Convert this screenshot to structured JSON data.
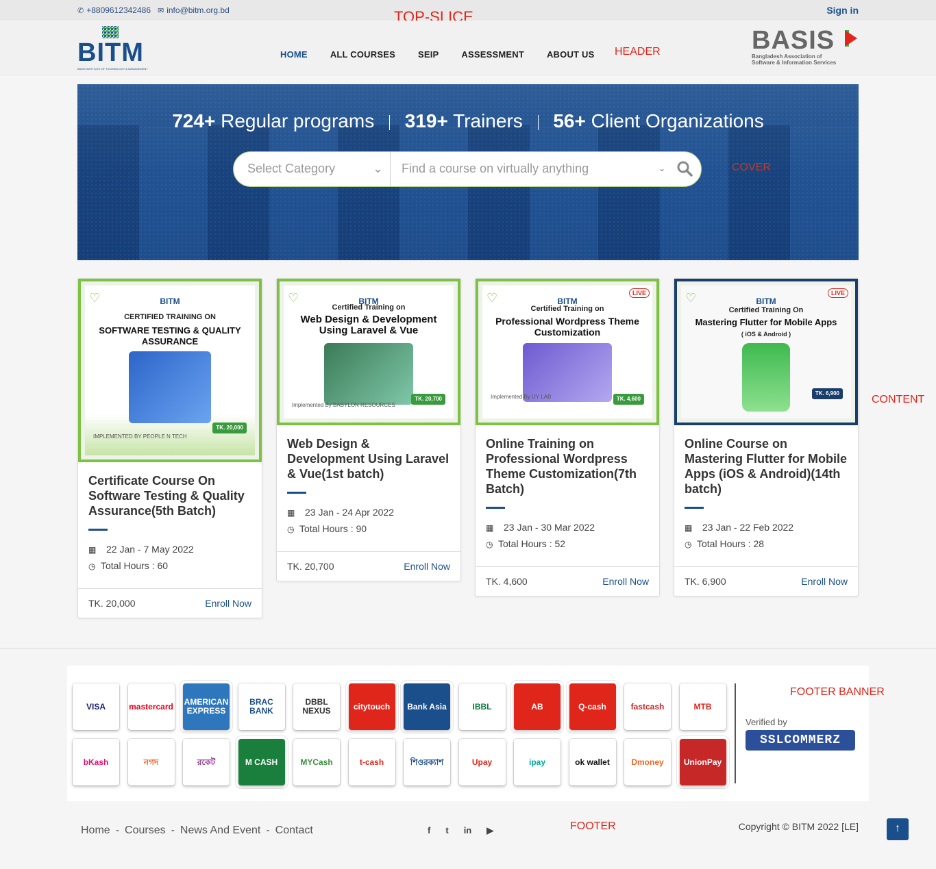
{
  "annotations": {
    "top_slice": "TOP-SLICE",
    "header": "HEADER",
    "cover": "COVER",
    "content": "CONTENT",
    "footer_banner": "FOOTER BANNER",
    "footer": "FOOTER"
  },
  "topbar": {
    "phone": "+8809612342486",
    "email": "info@bitm.org.bd",
    "signin": "Sign in"
  },
  "header": {
    "logo_text": "BITM",
    "logo_tagline": "BASIS INSTITUTE OF TECHNOLOGY & MANAGEMENT",
    "nav": [
      "HOME",
      "ALL COURSES",
      "SEIP",
      "ASSESSMENT",
      "ABOUT US"
    ],
    "active_nav": "HOME",
    "partner_logo": "BASIS",
    "partner_sub1": "Bangladesh Association of",
    "partner_sub2": "Software & Information Services"
  },
  "cover": {
    "stat1_num": "724+",
    "stat1_label": "Regular programs",
    "stat2_num": "319+",
    "stat2_label": "Trainers",
    "stat3_num": "56+",
    "stat3_label": "Client Organizations",
    "category_placeholder": "Select Category",
    "search_placeholder": "Find a course on virtually anything"
  },
  "courses": [
    {
      "banner_brand": "BITM",
      "banner_line1": "CERTIFIED TRAINING ON",
      "banner_line2": "SOFTWARE TESTING & QUALITY ASSURANCE",
      "banner_impl": "IMPLEMENTED BY PEOPLE N TECH",
      "banner_fee": "TK. 20,000",
      "live": false,
      "title": "Certificate Course On Software Testing & Quality Assurance(5th Batch)",
      "dates": "22 Jan - 7 May 2022",
      "hours": "Total Hours : 60",
      "price": "TK. 20,000",
      "enroll": "Enroll Now"
    },
    {
      "banner_brand": "BITM",
      "banner_line1": "Certified Training on",
      "banner_line2": "Web Design & Development Using Laravel & Vue",
      "banner_impl": "Implemented By BABYLON RESOURCES",
      "banner_fee": "TK. 20,700",
      "live": false,
      "title": "Web Design & Development Using Laravel & Vue(1st batch)",
      "dates": "23 Jan - 24 Apr 2022",
      "hours": "Total Hours : 90",
      "price": "TK. 20,700",
      "enroll": "Enroll Now"
    },
    {
      "banner_brand": "BITM",
      "banner_line1": "Certified Training on",
      "banner_line2": "Professional Wordpress Theme Customization",
      "banner_impl": "Implemented By UY LAB",
      "banner_fee": "TK. 4,600",
      "live": true,
      "title": "Online Training on Professional Wordpress Theme Customization(7th Batch)",
      "dates": "23 Jan - 30 Mar 2022",
      "hours": "Total Hours : 52",
      "price": "TK. 4,600",
      "enroll": "Enroll Now"
    },
    {
      "banner_brand": "BITM",
      "banner_line1": "Certified Training On",
      "banner_line2": "Mastering Flutter for Mobile Apps",
      "banner_sub": "( iOS & Android )",
      "banner_fee": "TK. 6,900",
      "live": true,
      "title": "Online Course on Mastering Flutter for Mobile Apps (iOS & Android)(14th batch)",
      "dates": "23 Jan - 22 Feb 2022",
      "hours": "Total Hours : 28",
      "price": "TK. 6,900",
      "enroll": "Enroll Now"
    }
  ],
  "live_label": "LIVE",
  "payments": {
    "row1": [
      "VISA",
      "mastercard",
      "AMERICAN EXPRESS",
      "BRAC BANK",
      "DBBL NEXUS",
      "citytouch",
      "Bank Asia",
      "IBBL",
      "AB",
      "Q-cash",
      "fastcash",
      "MTB"
    ],
    "row2": [
      "bKash",
      "নগদ",
      "রকেট",
      "M CASH",
      "MYCash",
      "t-cash",
      "শিওরক্যাশ",
      "Upay",
      "ipay",
      "ok wallet",
      "Dmoney",
      "UnionPay"
    ],
    "verified_by": "Verified by",
    "gateway": "SSLCOMMERZ"
  },
  "footer": {
    "links": [
      "Home",
      "Courses",
      "News And Event",
      "Contact"
    ],
    "social": [
      "facebook-icon",
      "twitter-icon",
      "linkedin-icon",
      "youtube-icon"
    ],
    "social_glyphs": [
      "f",
      "t",
      "in",
      "▶"
    ],
    "copyright": "Copyright © BITM 2022 [LE]",
    "to_top": "↑"
  }
}
